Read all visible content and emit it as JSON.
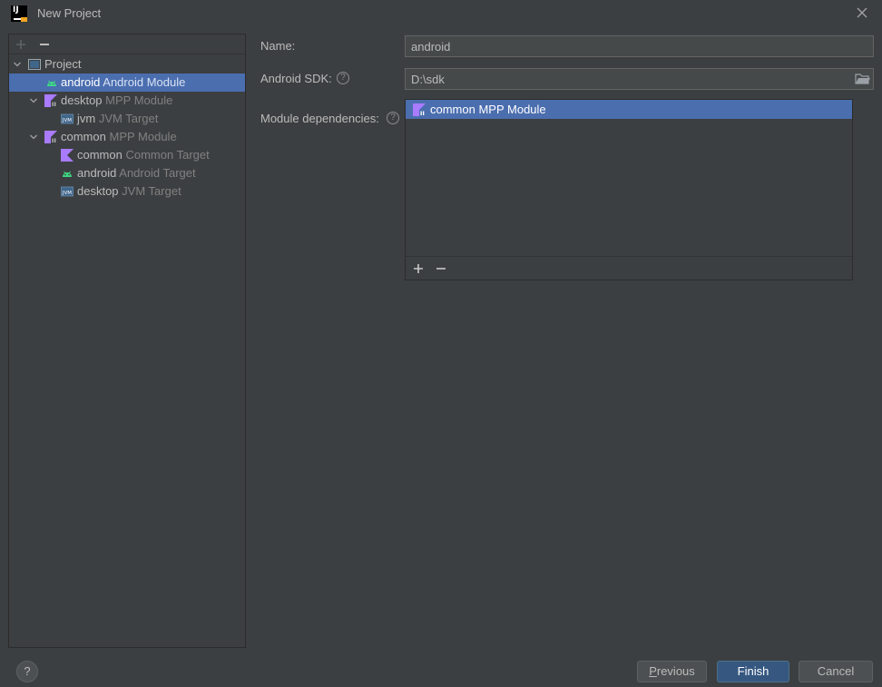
{
  "window": {
    "title": "New Project",
    "app_icon_text": "IJ",
    "close_icon": "close-icon"
  },
  "left_panel": {
    "toolbar": {
      "add_icon": "plus-icon",
      "remove_icon": "minus-icon"
    },
    "tree": [
      {
        "name": "Project",
        "sub": "",
        "icon": "project-folder-icon",
        "expanded": true
      },
      {
        "name": "android",
        "sub": "Android Module",
        "icon": "android-icon",
        "selected": true
      },
      {
        "name": "desktop",
        "sub": "MPP Module",
        "icon": "kotlin-module-icon",
        "expanded": true
      },
      {
        "name": "jvm",
        "sub": "JVM Target",
        "icon": "jvm-icon"
      },
      {
        "name": "common",
        "sub": "MPP Module",
        "icon": "kotlin-module-icon",
        "expanded": true
      },
      {
        "name": "common",
        "sub": "Common Target",
        "icon": "kotlin-icon"
      },
      {
        "name": "android",
        "sub": "Android Target",
        "icon": "android-icon"
      },
      {
        "name": "desktop",
        "sub": "JVM Target",
        "icon": "jvm-icon"
      }
    ]
  },
  "form": {
    "name_label": "Name:",
    "name_value": "android",
    "sdk_label": "Android SDK:",
    "sdk_value": "D:\\sdk",
    "deps_label": "Module dependencies:",
    "deps": [
      {
        "label": "common MPP Module",
        "icon": "kotlin-module-icon",
        "selected": true
      }
    ]
  },
  "buttons": {
    "help": "?",
    "previous_first": "P",
    "previous_rest": "revious",
    "finish": "Finish",
    "cancel": "Cancel"
  },
  "colors": {
    "background": "#3c3f41",
    "selection": "#4b6eaf",
    "android_green": "#3ddc84",
    "kotlin_purple": "#a97bff",
    "primary_button": "#365880"
  }
}
